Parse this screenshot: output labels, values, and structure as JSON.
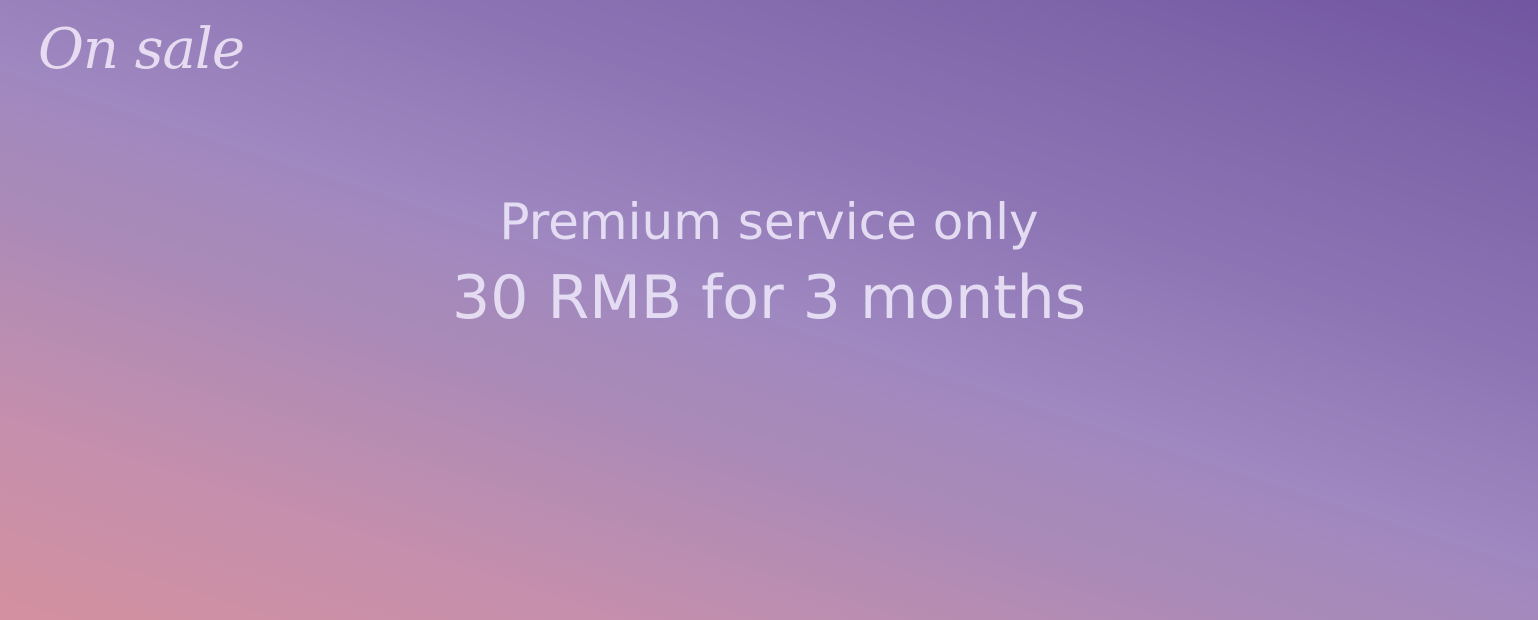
{
  "banner": {
    "tag": "On sale",
    "subtitle": "Premium service only",
    "offer": "30 RMB for 3 months"
  },
  "colors": {
    "gradient_bottom_left": "#d3909f",
    "gradient_center": "#9f88c0",
    "gradient_top_right": "#7155a1",
    "text": "#e8e0f4"
  }
}
